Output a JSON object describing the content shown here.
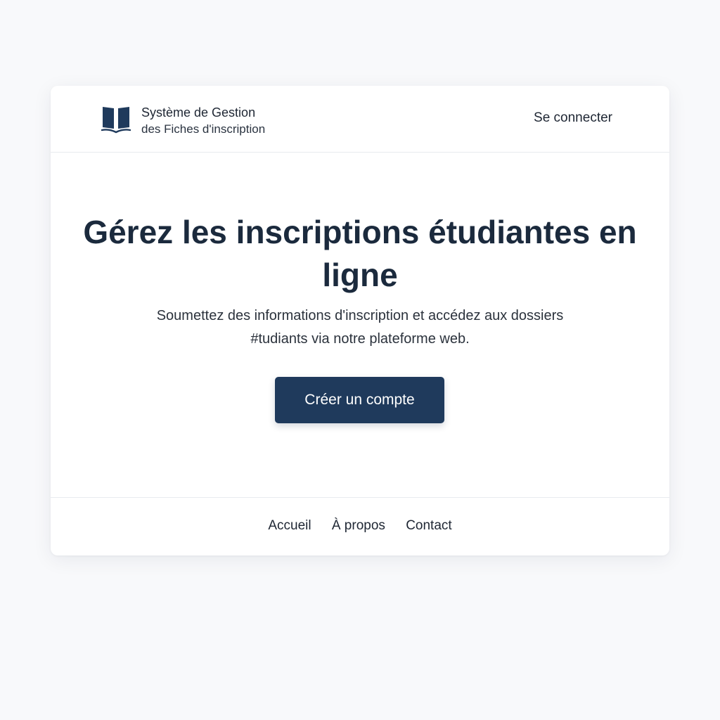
{
  "header": {
    "logo_icon": "open-book-icon",
    "brand_line1": "Système de Gestion",
    "brand_line2": "des Fiches d'inscription",
    "login_label": "Se connecter"
  },
  "hero": {
    "title": "Gérez les inscriptions étudiantes en ligne",
    "subtitle": "Soumettez des informations d'inscription et accédez aux dossiers #tudiants via notre plateforme web.",
    "cta_label": "Créer un compte"
  },
  "footer": {
    "links": [
      {
        "label": "Accueil"
      },
      {
        "label": "À propos"
      },
      {
        "label": "Contact"
      }
    ]
  },
  "colors": {
    "page_background": "#f8f9fb",
    "card_background": "#ffffff",
    "primary": "#1f3a5c",
    "heading": "#1b2a3d",
    "text": "#1e2633"
  }
}
